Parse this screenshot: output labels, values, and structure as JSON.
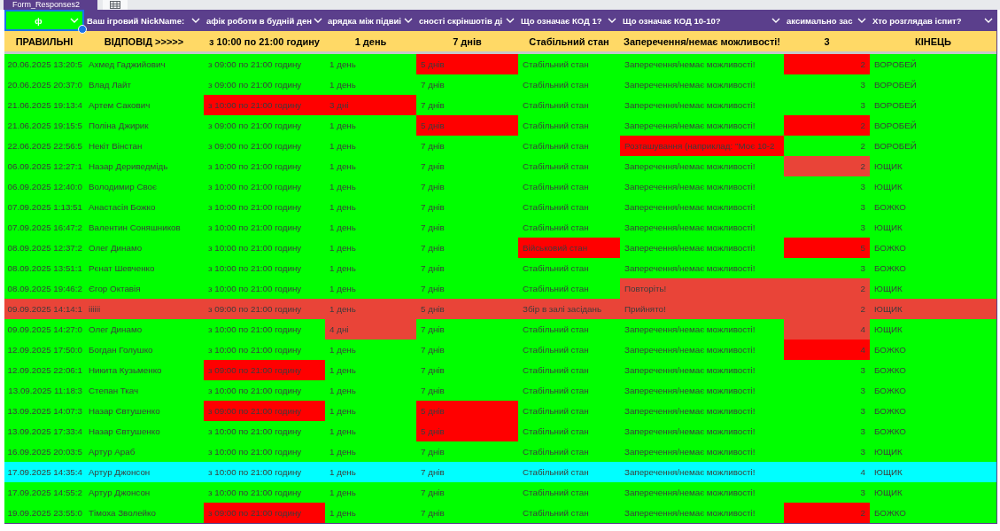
{
  "sheet_tabs": [
    {
      "label": "Form_Responses2",
      "kind": "text",
      "selected": true
    },
    {
      "kind": "grid",
      "selected": false
    }
  ],
  "header": [
    {
      "text": "ф",
      "selected": true,
      "color": "#00ff00"
    },
    {
      "text": "Ваш ігровий NickName:",
      "selected": false
    },
    {
      "text": "афік роботи в будній ден",
      "selected": false
    },
    {
      "text": "арядка між підвиі",
      "selected": false
    },
    {
      "text": "сності скріншотів ді",
      "selected": false
    },
    {
      "text": "Що означає КОД 1?",
      "selected": false
    },
    {
      "text": "Що означає КОД 10-10?",
      "selected": false
    },
    {
      "text": "аксимально зас",
      "selected": false
    },
    {
      "text": "Хто розглядав іспит?",
      "selected": false
    }
  ],
  "answers": [
    "ПРАВИЛЬНІ",
    "ВІДПОВІД >>>>>",
    "з 10:00 по 21:00 годину",
    "1 день",
    "7 днів",
    "Стабільний стан",
    "Заперечення/немає можливості!",
    "3",
    "КІНЕЦЬ"
  ],
  "rows": [
    {
      "color": "#00ff00",
      "cells": [
        "20.06.2025 13:20:5",
        "Ахмед Гаджийович",
        "з 09:00 по 21:00 годину",
        "1 день",
        {
          "text": "5 днів",
          "color": "#ff0000"
        },
        "Стабільний стан",
        "Заперечення/немає можливості!",
        {
          "text": "2",
          "color": "#ff0000"
        },
        "ВОРОБЕЙ"
      ]
    },
    {
      "color": "#00ff00",
      "cells": [
        "20.06.2025 20:37:0",
        "Влад Лайт",
        "з 09:00 по 21:00 годину",
        "1 день",
        "7 днів",
        "Стабільний стан",
        "Заперечення/немає можливості!",
        "3",
        "ВОРОБЕЙ"
      ]
    },
    {
      "color": "#00ff00",
      "cells": [
        "21.06.2025 19:13:4",
        "Артем Сакович",
        {
          "text": "з 10:00 по 21:00 годину",
          "color": "#ff0000"
        },
        {
          "text": "3 дні",
          "color": "#ff0000"
        },
        "7 днів",
        "Стабільний стан",
        "Заперечення/немає можливості!",
        "3",
        "ВОРОБЕЙ"
      ]
    },
    {
      "color": "#00ff00",
      "cells": [
        "21.06.2025 19:15:5",
        "Поліна Джирик",
        "з 09:00 по 21:00 годину",
        "1 день",
        {
          "text": "5 днів",
          "color": "#ff0000"
        },
        "Стабільний стан",
        "Заперечення/немає можливості!",
        {
          "text": "2",
          "color": "#ff0000"
        },
        "ВОРОБЕЙ"
      ]
    },
    {
      "color": "#00ff00",
      "cells": [
        "22.06.2025 22:56:5",
        "Некіт Вінстан",
        "з 09:00 по 21:00 годину",
        "1 день",
        "7 днів",
        "Стабільний стан",
        {
          "text": "Розташування (наприклад: \"Моє 10-2",
          "color": "#ff0000"
        },
        "2",
        "ВОРОБЕЙ"
      ]
    },
    {
      "color": "#00ff00",
      "cells": [
        "06.09.2025 12:27:1",
        "Назар Дериведмідь",
        "з 10:00 по 21:00 годину",
        "1 день",
        "7 днів",
        "Стабільний стан",
        "Заперечення/немає можливості!",
        {
          "text": "2",
          "color": "#e94438"
        },
        "ЮЩИК"
      ]
    },
    {
      "color": "#00ff00",
      "cells": [
        "06.09.2025 12:40:0",
        "Володимир Своє",
        "з 10:00 по 21:00 годину",
        "1 день",
        "7 днів",
        "Стабільний стан",
        "Заперечення/немає можливості!",
        "3",
        "ЮЩИК"
      ]
    },
    {
      "color": "#00ff00",
      "cells": [
        "07.09.2025 1:13:51",
        "Анастасія Божко",
        "з 10:00 по 21:00 годину",
        "1 день",
        "7 днів",
        "Стабільний стан",
        "Заперечення/немає можливості!",
        "3",
        "БОЖКО"
      ]
    },
    {
      "color": "#00ff00",
      "cells": [
        "07.09.2025 16:47:2",
        "Валентин Соняшников",
        "з 10:00 по 21:00 годину",
        "1 день",
        "7 днів",
        "Стабільний стан",
        "Заперечення/немає можливості!",
        "3",
        "ЮЩИК"
      ]
    },
    {
      "color": "#00ff00",
      "cells": [
        "08.09.2025 12:37:2",
        "Олег Динамо",
        "з 10:00 по 21:00 годину",
        "1 день",
        "7 днів",
        {
          "text": "Військовий стан",
          "color": "#ff0000"
        },
        "Заперечення/немає можливості!",
        {
          "text": "5",
          "color": "#ff0000"
        },
        "БОЖКО"
      ]
    },
    {
      "color": "#00ff00",
      "cells": [
        "08.09.2025 13:51:1",
        "Рєнат Шевченко",
        "з 10:00 по 21:00 годину",
        "1 день",
        "7 днів",
        "Стабільний стан",
        "Заперечення/немає можливості!",
        "3",
        "БОЖКО"
      ]
    },
    {
      "color": "#00ff00",
      "cells": [
        "08.09.2025 19:46:2",
        "Єгор Октавія",
        "з 10:00 по 21:00 годину",
        "1 день",
        "7 днів",
        "Стабільний стан",
        {
          "text": "Повторіть!",
          "color": "#e94438"
        },
        {
          "text": "2",
          "color": "#e94438"
        },
        "ЮЩИК"
      ]
    },
    {
      "color": "#e94438",
      "cells": [
        "09.09.2025 14:14:1",
        "iiiiii",
        "з 09:00 по 21:00 годину",
        "1 день",
        "5 днів",
        "Збір в залі засідань",
        "Прийнято!",
        "2",
        "ЮЩИК"
      ]
    },
    {
      "color": "#00ff00",
      "cells": [
        "09.09.2025 14:27:0",
        "Олег Динамо",
        "з 10:00 по 21:00 годину",
        {
          "text": "4 дні",
          "color": "#e94438"
        },
        "7 днів",
        "Стабільний стан",
        "Заперечення/немає можливості!",
        {
          "text": "4",
          "color": "#e94438"
        },
        "ЮЩИК"
      ]
    },
    {
      "color": "#00ff00",
      "cells": [
        "12.09.2025 17:50:0",
        "Богдан Голушко",
        "з 10:00 по 21:00 годину",
        "1 день",
        "7 днів",
        "Стабільний стан",
        "Заперечення/немає можливості!",
        {
          "text": "4",
          "color": "#ff0000"
        },
        "БОЖКО"
      ]
    },
    {
      "color": "#00ff00",
      "cells": [
        "12.09.2025 22:06:1",
        "Никита Кузьменко",
        {
          "text": "з 09:00 по 21:00 годину",
          "color": "#ff0000"
        },
        "1 день",
        "7 днів",
        "Стабільний стан",
        "Заперечення/немає можливості!",
        "3",
        "БОЖКО"
      ]
    },
    {
      "color": "#00ff00",
      "cells": [
        "13.09.2025 11:18:3",
        "Степан Ткач",
        "з 10:00 по 21:00 годину",
        "1 день",
        "7 днів",
        "Стабільний стан",
        "Заперечення/немає можливості!",
        "3",
        "БОЖКО"
      ]
    },
    {
      "color": "#00ff00",
      "cells": [
        "13.09.2025 14:07:3",
        "Назар Євтушенко",
        {
          "text": "з 09:00 по 21:00 годину",
          "color": "#ff0000"
        },
        "1 день",
        {
          "text": "5 днів",
          "color": "#ff0000"
        },
        "Стабільний стан",
        "Заперечення/немає можливості!",
        "3",
        "БОЖКО"
      ]
    },
    {
      "color": "#00ff00",
      "cells": [
        "13.09.2025 17:33:4",
        "Назар Євтушенко",
        "з 10:00 по 21:00 годину",
        "1 день",
        {
          "text": "5 днів",
          "color": "#ff0000"
        },
        "Стабільний стан",
        "Заперечення/немає можливості!",
        "3",
        "БОЖКО"
      ]
    },
    {
      "color": "#00ff00",
      "cells": [
        "16.09.2025 20:03:5",
        "Артур Араб",
        "з 10:00 по 21:00 годину",
        "1 день",
        "7 днів",
        "Стабільний стан",
        "Заперечення/немає можливості!",
        "3",
        "ЮЩИК"
      ]
    },
    {
      "color": "#00ffff",
      "cells": [
        "17.09.2025 14:35:4",
        "Артур Джонсон",
        "з 10:00 по 21:00 годину",
        "1 день",
        "7 днів",
        "Стабільний стан",
        "Заперечення/немає можливості!",
        "4",
        "ЮЩИК"
      ]
    },
    {
      "color": "#00ff00",
      "cells": [
        "17.09.2025 14:55:2",
        "Артур Джонсон",
        "з 10:00 по 21:00 годину",
        "1 день",
        "7 днів",
        "Стабільний стан",
        "Заперечення/немає можливості!",
        "3",
        "ЮЩИК"
      ]
    },
    {
      "color": "#00ff00",
      "cells": [
        "19.09.2025 23:55:0",
        "Тімоха Зволейко",
        {
          "text": "з 09:00 по 21:00 годину",
          "color": "#ff0000"
        },
        "1 день",
        "7 днів",
        "Стабільний стан",
        "Заперечення/немає можливості!",
        {
          "text": "2",
          "color": "#ff0000"
        },
        "БОЖКО"
      ]
    }
  ]
}
